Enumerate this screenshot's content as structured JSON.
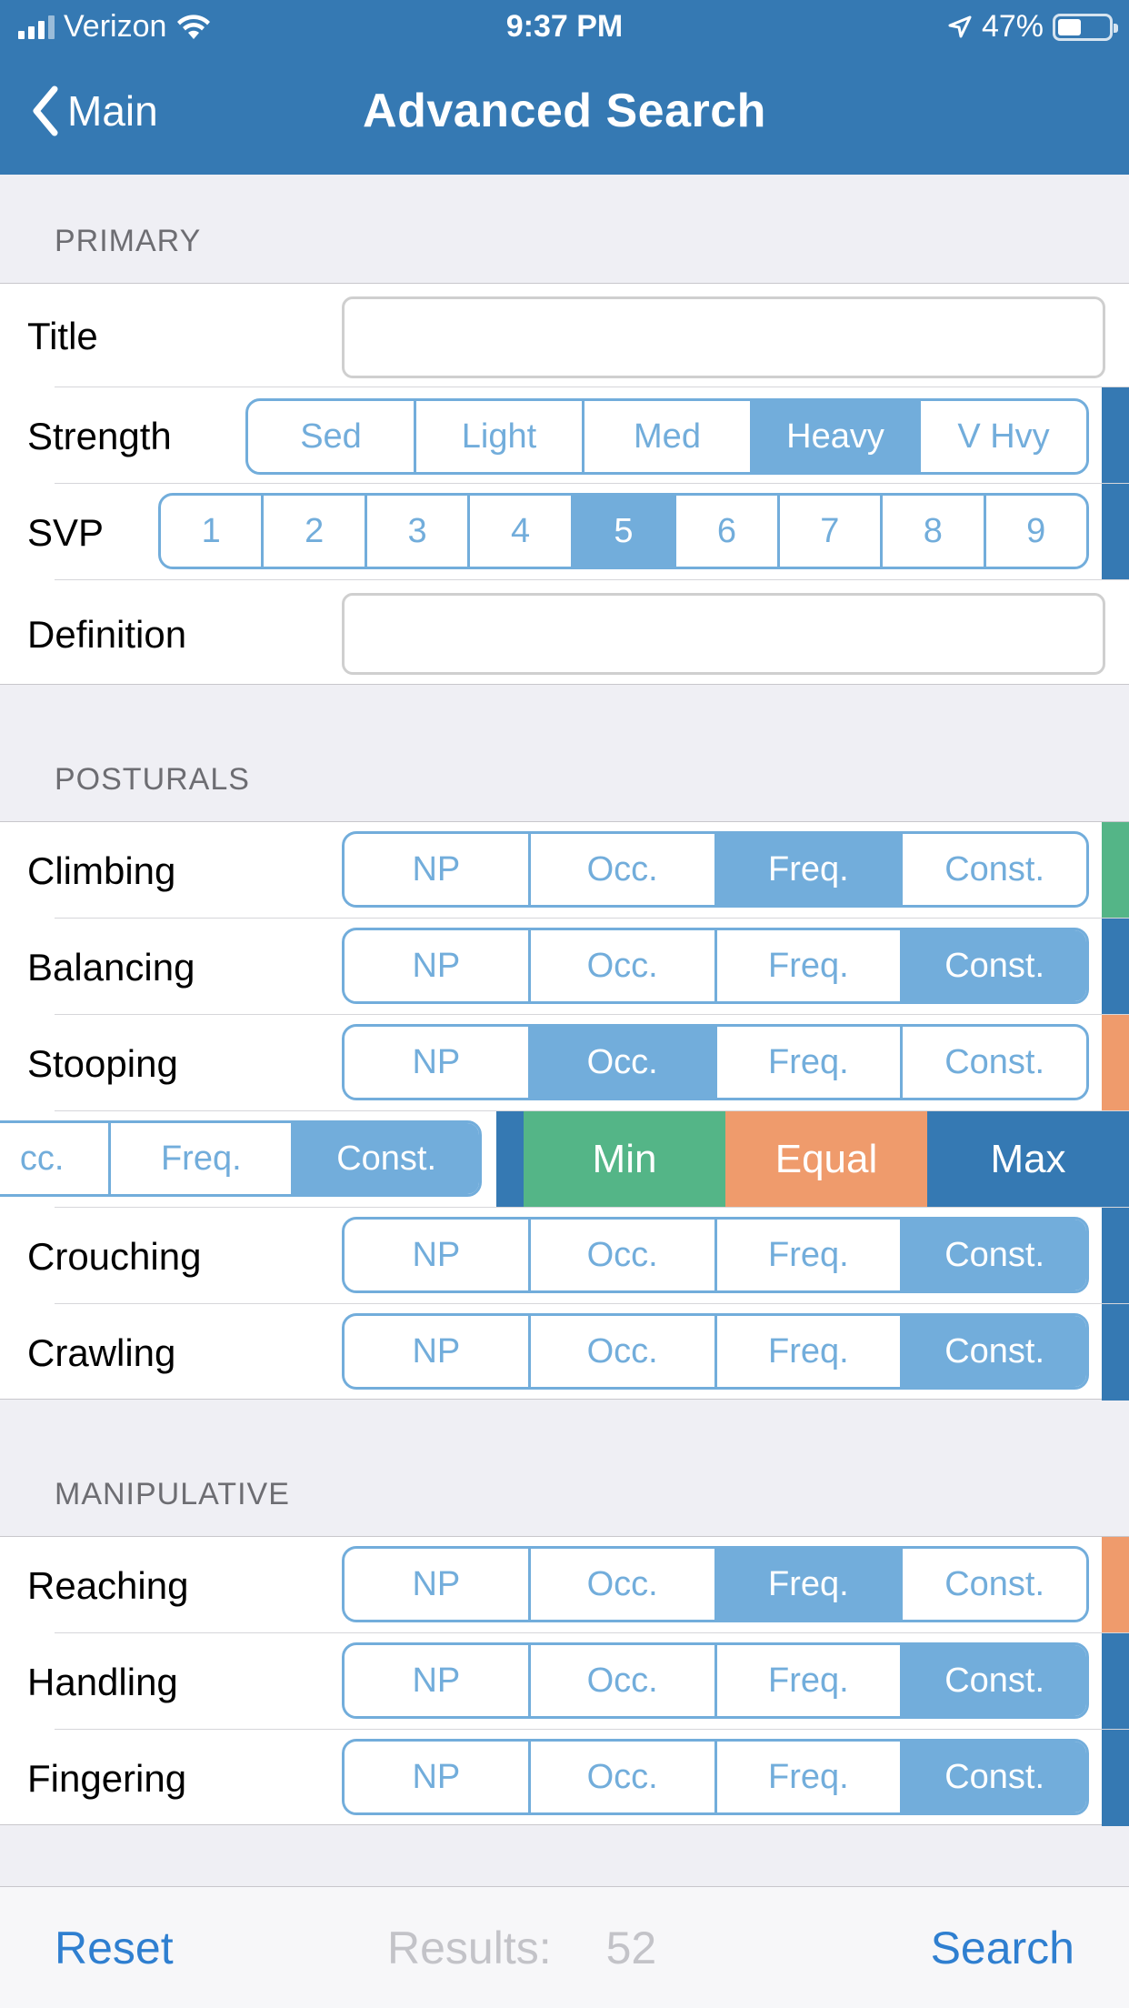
{
  "status": {
    "carrier": "Verizon",
    "time": "9:37 PM",
    "battery": "47%",
    "battery_level": 0.47
  },
  "nav": {
    "back_label": "Main",
    "title": "Advanced Search"
  },
  "primary": {
    "header": "PRIMARY",
    "title_label": "Title",
    "title_value": "",
    "strength_label": "Strength",
    "strength_options": [
      "Sed",
      "Light",
      "Med",
      "Heavy",
      "V Hvy"
    ],
    "strength_selected": "Heavy",
    "svp_label": "SVP",
    "svp_options": [
      "1",
      "2",
      "3",
      "4",
      "5",
      "6",
      "7",
      "8",
      "9"
    ],
    "svp_selected": "5",
    "definition_label": "Definition",
    "definition_value": ""
  },
  "posturals": {
    "header": "POSTURALS",
    "freq_options": [
      "NP",
      "Occ.",
      "Freq.",
      "Const."
    ],
    "rows": [
      {
        "label": "Climbing",
        "selected": "Freq.",
        "indicator": "#54b587"
      },
      {
        "label": "Balancing",
        "selected": "Const.",
        "indicator": "#3579b3"
      },
      {
        "label": "Stooping",
        "selected": "Occ.",
        "indicator": "#ef9b6c"
      },
      {
        "label": "",
        "selected": "Const.",
        "indicator": "#3579b3"
      },
      {
        "label": "Crouching",
        "selected": "Const.",
        "indicator": "#3579b3"
      },
      {
        "label": "Crawling",
        "selected": "Const.",
        "indicator": "#3579b3"
      }
    ],
    "swiped_visible_options": [
      "cc.",
      "Freq.",
      "Const."
    ],
    "swipe_actions": [
      {
        "label": "Min",
        "color": "#54b587"
      },
      {
        "label": "Equal",
        "color": "#ef9b6c"
      },
      {
        "label": "Max",
        "color": "#3579b3"
      }
    ]
  },
  "manipulative": {
    "header": "MANIPULATIVE",
    "rows": [
      {
        "label": "Reaching",
        "selected": "Freq.",
        "indicator": "#ef9b6c"
      },
      {
        "label": "Handling",
        "selected": "Const.",
        "indicator": "#3579b3"
      },
      {
        "label": "Fingering",
        "selected": "Const.",
        "indicator": "#3579b3"
      }
    ]
  },
  "toolbar": {
    "reset_label": "Reset",
    "results_label": "Results:",
    "results_count": "52",
    "search_label": "Search"
  }
}
